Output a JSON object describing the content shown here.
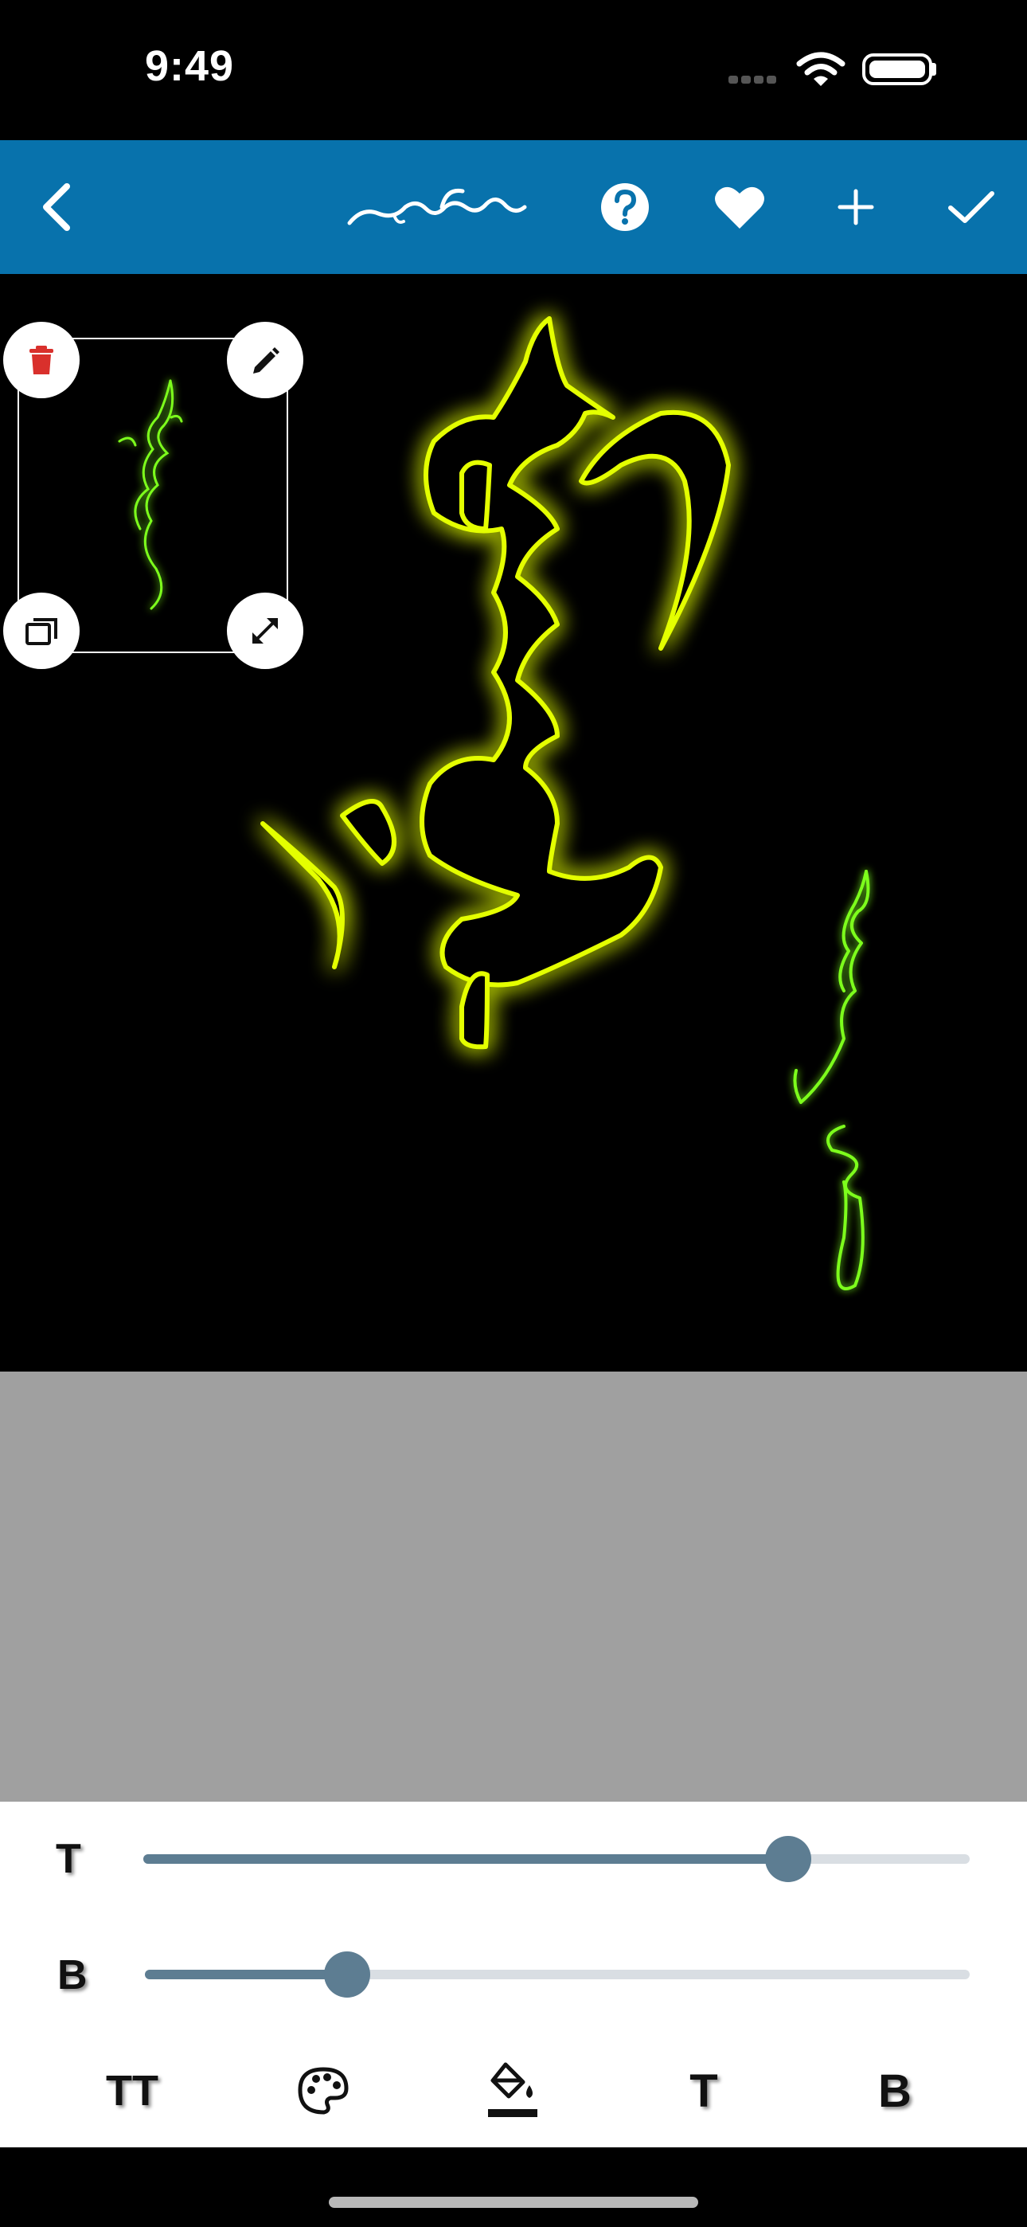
{
  "status_bar": {
    "time": "9:49",
    "icons": [
      "cell-signal-icon",
      "wifi-icon",
      "battery-icon"
    ]
  },
  "header": {
    "background": "#0872ac",
    "actions": [
      "back-icon",
      "mongolian-title-logo",
      "help-icon",
      "favorite-icon",
      "add-icon",
      "confirm-icon"
    ]
  },
  "canvas": {
    "background": "#000000",
    "glow_color": "#e4ff00",
    "outline_color": "#7dff1a",
    "selected_layer_actions": [
      "delete-icon",
      "edit-icon",
      "duplicate-icon",
      "resize-icon"
    ]
  },
  "sliders": [
    {
      "label": "T",
      "value": 0.78
    },
    {
      "label": "B",
      "value": 0.245
    }
  ],
  "toolbar": {
    "text_size_label": "TT",
    "color_icon": "palette-icon",
    "fill_icon": "fill-color-icon",
    "text_label": "T",
    "bold_label": "B"
  },
  "colors": {
    "slider_active": "#5d7d92",
    "slider_track": "#d9dee3",
    "empty_area": "#a0a0a0"
  }
}
